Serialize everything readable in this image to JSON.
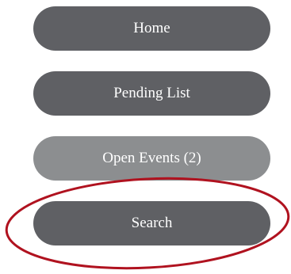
{
  "nav": {
    "items": [
      {
        "label": "Home",
        "color": "#5f6064"
      },
      {
        "label": "Pending List",
        "color": "#5f6064"
      },
      {
        "label": "Open Events (2)",
        "color": "#8c8e90"
      },
      {
        "label": "Search",
        "color": "#5f6064"
      }
    ]
  },
  "annotation": {
    "color": "#b0121f"
  }
}
